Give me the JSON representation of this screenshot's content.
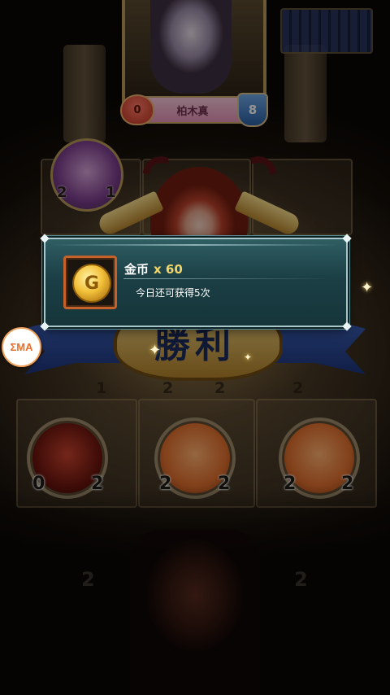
{
  "opponent": {
    "name": "柏木真",
    "hp": "0",
    "armor": "8"
  },
  "board": {
    "top_unit": {
      "attack": "2",
      "hp": "1"
    },
    "mid_row": [
      "1",
      "2",
      "2",
      "2"
    ],
    "player_units": [
      {
        "attack": "0",
        "hp": "2"
      },
      {
        "attack": "2",
        "hp": "2"
      },
      {
        "attack": "2",
        "hp": "2"
      }
    ],
    "bottom_row": [
      "2",
      "2"
    ]
  },
  "banner": {
    "text": "勝利"
  },
  "reward_popup": {
    "item_name": "金币",
    "quantity": "x 60",
    "subtitle": "今日还可获得5次",
    "coin_glyph": "G"
  },
  "floating_button": {
    "label": "ΣMA"
  },
  "colors": {
    "popup_bg": "#1b3f45",
    "popup_border": "#a9c7c9",
    "quantity_color": "#f3d66a",
    "icon_border": "#c4622a",
    "floating_accent": "#e8702a"
  }
}
